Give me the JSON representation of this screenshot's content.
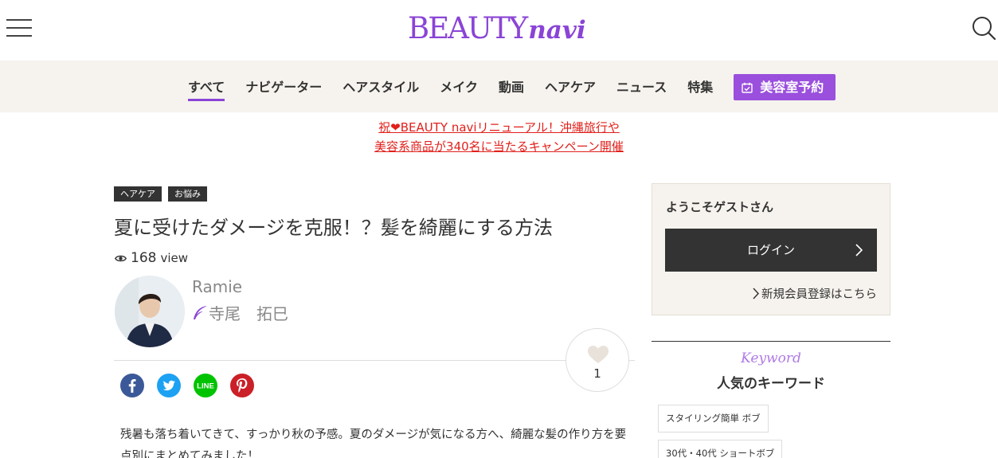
{
  "header": {
    "logo_main": "BEAUTY",
    "logo_sub": "navi",
    "menu_icon": "hamburger-menu-icon",
    "search_icon": "search-icon"
  },
  "nav": {
    "items": [
      {
        "label": "すべて",
        "active": true
      },
      {
        "label": "ナビゲーター"
      },
      {
        "label": "ヘアスタイル"
      },
      {
        "label": "メイク"
      },
      {
        "label": "動画"
      },
      {
        "label": "ヘアケア"
      },
      {
        "label": "ニュース"
      },
      {
        "label": "特集"
      }
    ],
    "reserve_label": "美容室予約",
    "reserve_icon": "calendar-check-icon",
    "accent_color": "#9a4fdd"
  },
  "campaign": {
    "line1": "祝❤BEAUTY naviリニューアル！沖縄旅行や",
    "line2": "美容系商品が340名に当たるキャンペーン開催",
    "color": "#e0201b"
  },
  "article": {
    "tags": [
      "ヘアケア",
      "お悩み"
    ],
    "title": "夏に受けたダメージを克服！？髪を綺麗にする方法",
    "views": "168",
    "views_unit": "view",
    "author": {
      "name": "Ramie",
      "stylist": "寺尾　拓巳"
    },
    "like_count": "1",
    "share_icons": [
      "facebook-icon",
      "twitter-icon",
      "line-icon",
      "pinterest-icon"
    ],
    "intro": "残暑も落ち着いてきて、すっかり秋の予感。夏のダメージが気になる方へ、綺麗な髪の作り方を要点別にまとめてみました！"
  },
  "sidebar": {
    "welcome_title": "ようこそゲストさん",
    "login_label": "ログイン",
    "register_label": "新規会員登録はこちら",
    "keyword_script": "Keyword",
    "keyword_title": "人気のキーワード",
    "keywords": [
      "スタイリング簡単 ボブ",
      "30代・40代 ショートボブ"
    ]
  }
}
